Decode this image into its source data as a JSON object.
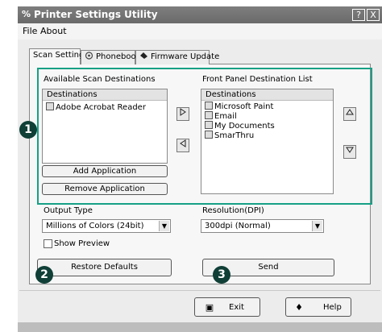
{
  "window": {
    "title": "Printer Settings Utility",
    "help_button": "?",
    "close_button": "X"
  },
  "menu": {
    "file": "File",
    "about": "About"
  },
  "tabs": [
    {
      "label": "Scan Settings",
      "active": true
    },
    {
      "label": "Phonebook",
      "active": false
    },
    {
      "label": "Firmware Update",
      "active": false
    }
  ],
  "available": {
    "title": "Available Scan Destinations",
    "header": "Destinations",
    "items": [
      "Adobe Acrobat Reader"
    ]
  },
  "front_panel": {
    "title": "Front Panel Destination List",
    "header": "Destinations",
    "items": [
      "Microsoft Paint",
      "Email",
      "My Documents",
      "SmarThru"
    ]
  },
  "buttons": {
    "add_application": "Add Application",
    "remove_application": "Remove Application",
    "restore_defaults": "Restore Defaults",
    "send": "Send",
    "exit": "Exit",
    "help": "Help"
  },
  "output_type": {
    "label": "Output Type",
    "value": "Millions of Colors (24bit)"
  },
  "resolution": {
    "label": "Resolution(DPI)",
    "value": "300dpi (Normal)"
  },
  "show_preview": {
    "label": "Show Preview",
    "checked": false
  },
  "callouts": [
    "1",
    "2",
    "3"
  ],
  "colors": {
    "highlight": "#16a085",
    "callout": "#0f3f36",
    "titlebar": "#747474"
  }
}
